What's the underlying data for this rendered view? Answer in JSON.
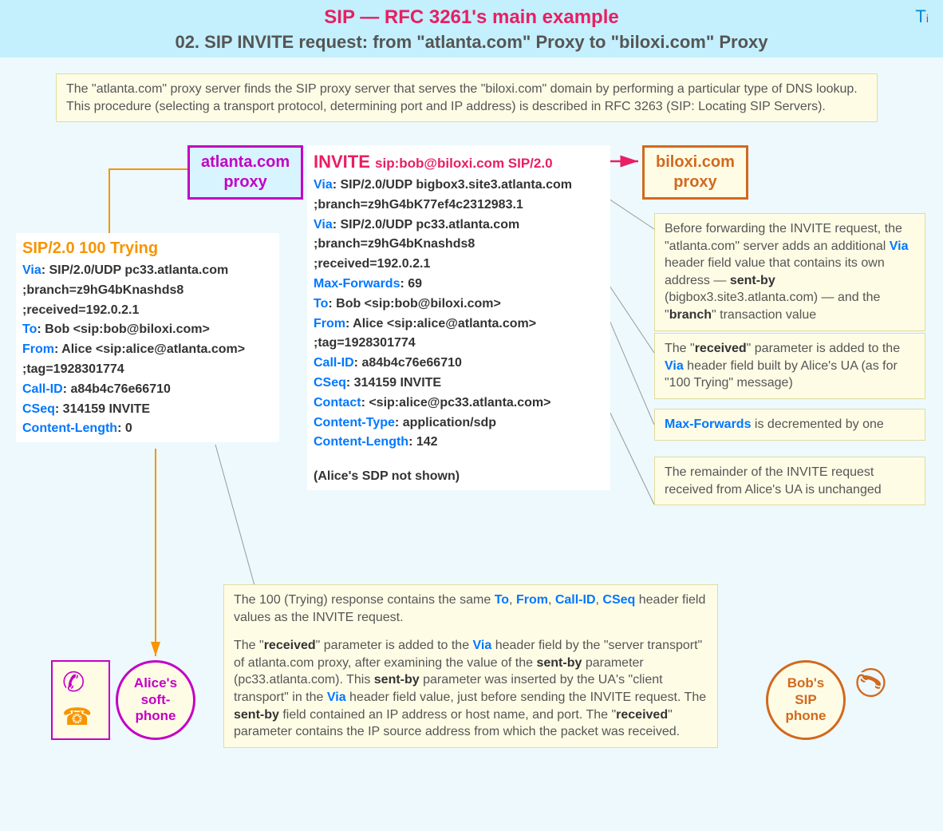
{
  "header": {
    "title": "SIP — RFC 3261's main example",
    "subtitle": "02.  SIP INVITE request: from \"atlanta.com\" Proxy to \"biloxi.com\" Proxy",
    "logo_t": "T",
    "logo_i": "i"
  },
  "top_note": "The \"atlanta.com\" proxy server finds the SIP proxy server that serves the \"biloxi.com\" domain by performing a particular type of DNS lookup. This procedure (selecting a transport protocol, determining port and IP address) is described in RFC 3263 (SIP: Locating SIP Servers).",
  "atlanta_proxy": {
    "line1": "atlanta.com",
    "line2": "proxy"
  },
  "biloxi_proxy": {
    "line1": "biloxi.com",
    "line2": "proxy"
  },
  "invite": {
    "method": "INVITE",
    "uri": "sip:bob@biloxi.com SIP/2.0",
    "lines": [
      {
        "k": "Via",
        "v": ": SIP/2.0/UDP bigbox3.site3.atlanta.com"
      },
      {
        "k": "",
        "v": " ;branch=z9hG4bK77ef4c2312983.1"
      },
      {
        "k": "Via",
        "v": ": SIP/2.0/UDP pc33.atlanta.com"
      },
      {
        "k": "",
        "v": " ;branch=z9hG4bKnashds8"
      },
      {
        "k": "",
        "v": " ;received=192.0.2.1"
      },
      {
        "k": "Max-Forwards",
        "v": ": 69"
      },
      {
        "k": "To",
        "v": ": Bob <sip:bob@biloxi.com>"
      },
      {
        "k": "From",
        "v": ": Alice <sip:alice@atlanta.com>"
      },
      {
        "k": "",
        "v": " ;tag=1928301774"
      },
      {
        "k": "Call-ID",
        "v": ": a84b4c76e66710"
      },
      {
        "k": "CSeq",
        "v": ": 314159 INVITE"
      },
      {
        "k": "Contact",
        "v": ": <sip:alice@pc33.atlanta.com>"
      },
      {
        "k": "Content-Type",
        "v": ": application/sdp"
      },
      {
        "k": "Content-Length",
        "v": ": 142"
      }
    ],
    "footer": "(Alice's SDP not shown)"
  },
  "trying": {
    "title": "SIP/2.0 100 Trying",
    "lines": [
      {
        "k": "Via",
        "v": ": SIP/2.0/UDP pc33.atlanta.com"
      },
      {
        "k": "",
        "v": " ;branch=z9hG4bKnashds8"
      },
      {
        "k": "",
        "v": " ;received=192.0.2.1"
      },
      {
        "k": "To",
        "v": ": Bob <sip:bob@biloxi.com>"
      },
      {
        "k": "From",
        "v": ": Alice <sip:alice@atlanta.com>"
      },
      {
        "k": "",
        "v": " ;tag=1928301774"
      },
      {
        "k": "Call-ID",
        "v": ": a84b4c76e66710"
      },
      {
        "k": "CSeq",
        "v": ": 314159 INVITE"
      },
      {
        "k": "Content-Length",
        "v": ": 0"
      }
    ]
  },
  "side_notes": {
    "n1_pre": "Before forwarding the INVITE request, the \"atlanta.com\" server adds an additional ",
    "n1_via": "Via",
    "n1_mid": " header field value that contains its own address — ",
    "n1_sentby": "sent-by",
    "n1_post": " (bigbox3.site3.atlanta.com) — and the \"",
    "n1_branch": "branch",
    "n1_end": "\" transaction value",
    "n2_pre": "The \"",
    "n2_recv": "received",
    "n2_mid": "\" parameter is added to the ",
    "n2_via": "Via",
    "n2_post": " header field built by Alice's UA (as for \"100 Trying\" message)",
    "n3_mf": "Max-Forwards",
    "n3_post": " is decremented by one",
    "n4": "The remainder of the INVITE request received from Alice's UA is unchanged"
  },
  "bottom_note": {
    "p1_pre": "The 100 (Trying) response contains the same ",
    "p1_to": "To",
    "p1_c1": ", ",
    "p1_from": "From",
    "p1_c2": ", ",
    "p1_cid": "Call-ID",
    "p1_c3": ", ",
    "p1_cseq": "CSeq",
    "p1_post": " header field values as the INVITE request.",
    "p2_a": "The \"",
    "p2_recv1": "received",
    "p2_b": "\" parameter is added to the ",
    "p2_via1": "Via",
    "p2_c": " header field by the \"server transport\" of atlanta.com proxy, after examining the value of the ",
    "p2_sentby1": "sent-by",
    "p2_d": " parameter (pc33.atlanta.com). This ",
    "p2_sentby2": "sent-by",
    "p2_e": " parameter was inserted by the UA's \"client transport\" in the ",
    "p2_via2": "Via",
    "p2_f": " header field value, just before sending the INVITE request. The ",
    "p2_sentby3": "sent-by",
    "p2_g": " field contained an IP address or host name, and port. The \"",
    "p2_recv2": "received",
    "p2_h": "\" parameter contains the IP source address from which the packet was received."
  },
  "alice_phone": "Alice's\nsoft-\nphone",
  "bob_phone": "Bob's\nSIP\nphone"
}
